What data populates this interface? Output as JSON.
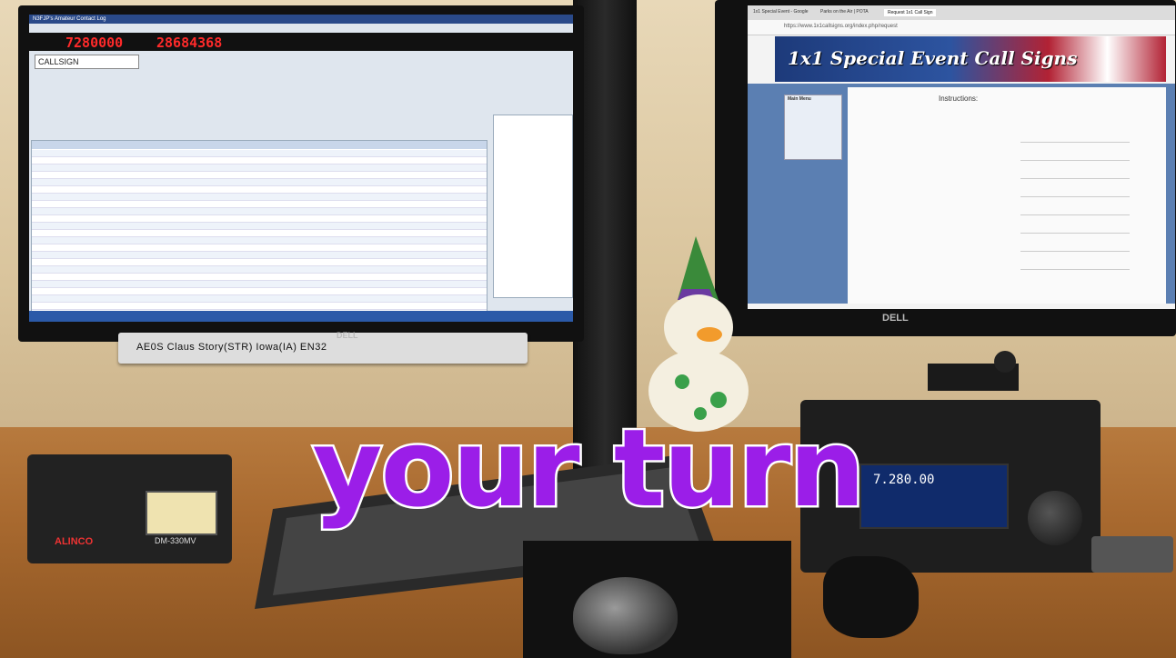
{
  "logger": {
    "window_title": "N3FJP's Amateur Contact Log",
    "frequency_a": "7280000",
    "frequency_b": "28684368",
    "callsign_field": "CALLSIGN"
  },
  "speaker": {
    "label": "AE0S  Claus  Story(STR)  Iowa(IA)  EN32",
    "brand": "DELL"
  },
  "browser": {
    "tabs": [
      "1x1 Special Event - Google",
      "Parks on the Air | POTA",
      "Request 1x1 Call Sign"
    ],
    "url": "https://www.1x1callsigns.org/index.php/request",
    "site_title": "1x1 Special Event Call Signs",
    "menu_title": "Main Menu",
    "instructions_title": "Instructions:"
  },
  "right_monitor_brand": "DELL",
  "amplifier": {
    "brand": "ALINCO",
    "model": "DM-330MV"
  },
  "radio": {
    "frequency": "7.280.00"
  },
  "overlay": {
    "text": "your turn",
    "color": "#9b1ee8",
    "stroke": "#ffffff"
  }
}
